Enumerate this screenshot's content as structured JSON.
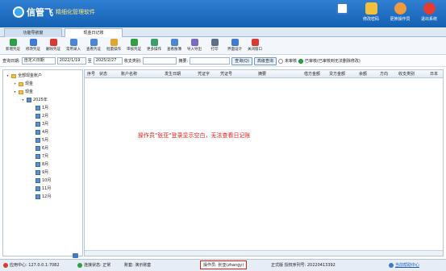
{
  "app": {
    "logo_text": "信管飞",
    "logo_sub": "精细化管理软件"
  },
  "header_buttons": [
    {
      "label": "",
      "icon": "document-icon"
    },
    {
      "label": "修改密码",
      "icon": "lock-icon"
    },
    {
      "label": "更换操作员",
      "icon": "user-icon"
    },
    {
      "label": "退出系统",
      "icon": "exit-icon"
    }
  ],
  "tabs": [
    "功能导航窗",
    "现金日记账"
  ],
  "toolbar": [
    {
      "label": "新增凭证",
      "color": "#2f9e44"
    },
    {
      "label": "修改凭证",
      "color": "#3d7bd6"
    },
    {
      "label": "删除凭证",
      "color": "#d93a32"
    },
    {
      "label": "常用录入",
      "color": "#4a86d4"
    },
    {
      "label": "查看凭证",
      "color": "#4a86d4"
    },
    {
      "label": "批量操作",
      "color": "#e0a52b"
    },
    {
      "label": "审核凭证",
      "color": "#2f9e44"
    },
    {
      "label": "更多操作",
      "color": "#3d9e6a"
    },
    {
      "label": "查看账簿",
      "color": "#4a86d4"
    },
    {
      "label": "导入导出",
      "color": "#7a6ac4"
    },
    {
      "label": "打印",
      "color": "#5b6f86"
    },
    {
      "label": "界面设计",
      "color": "#3d7bd6"
    },
    {
      "label": "关闭窗口",
      "color": "#d93a32"
    }
  ],
  "filter": {
    "date_label": "查询日期:",
    "date_mode": "自定义日期",
    "date_from": "2022/1/19",
    "to_label": "至",
    "date_to": "2025/2/27",
    "category_label": "收支类别:",
    "category_value": "",
    "summary_label": "摘要:",
    "summary_value": "",
    "query_button": "查询(Q)",
    "advanced_button": "高级查询",
    "unaudited_label": "未审核",
    "audited_label": "已审核(已审核到无法删除修改)"
  },
  "tree": {
    "root": "全部现金账户",
    "nodes": [
      "现金",
      "现金"
    ],
    "year": "2025年",
    "months": [
      "1月",
      "2月",
      "3月",
      "4月",
      "5月",
      "6月",
      "7月",
      "8月",
      "9月",
      "10月",
      "11月",
      "12月"
    ]
  },
  "grid": {
    "columns": [
      "序号",
      "状态",
      "账户名称",
      "发生日期",
      "凭证字",
      "凭证号",
      "摘要",
      "借方金额",
      "贷方金额",
      "余额",
      "方向",
      "收支类别",
      "日本"
    ],
    "annotation": "操作员\"张亚\"登录显示空白，无法查看日记账"
  },
  "statusbar": {
    "server": "应用中心: 127.0.0.1:7082",
    "connection": "连接状态: 正常",
    "account": "账套: 演示账套",
    "operator": "操作员: 张亚(zhangy)",
    "version": "正式版  授权序列号: 20220413392",
    "link": "当前帮助中心"
  },
  "colors": {
    "header": "#1f6fc4",
    "accent": "#2f9e44",
    "annotation": "#e31b1b"
  }
}
